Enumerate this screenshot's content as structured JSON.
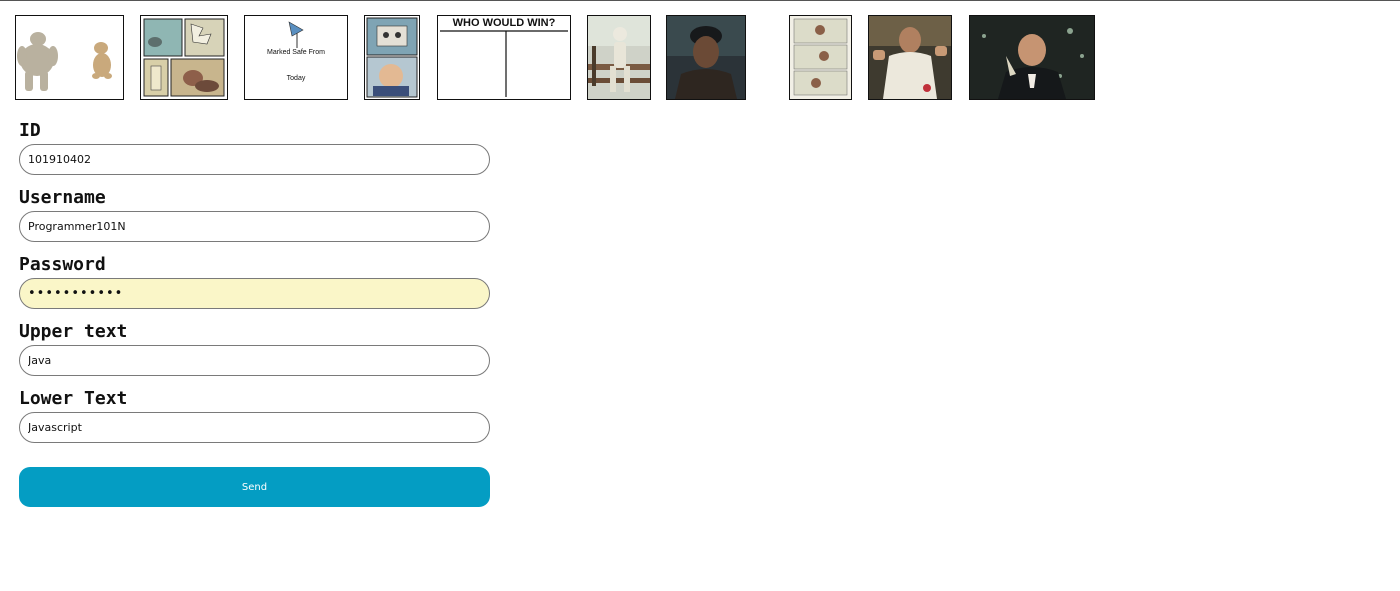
{
  "templates": [
    {
      "name": "swole-doge-vs-cheems"
    },
    {
      "name": "comic-strip"
    },
    {
      "name": "marked-safe-from",
      "text_top": "Marked Safe From",
      "text_bottom": "Today"
    },
    {
      "name": "two-buttons-comic"
    },
    {
      "name": "who-would-win",
      "text_top": "WHO WOULD WIN?"
    },
    {
      "name": "skeleton-on-bench"
    },
    {
      "name": "man-in-hat"
    },
    {
      "name": "three-panel-comic"
    },
    {
      "name": "buddy-christ"
    },
    {
      "name": "leonardo-toast"
    }
  ],
  "form": {
    "id": {
      "label": "ID",
      "value": "101910402"
    },
    "username": {
      "label": "Username",
      "value": "Programmer101N"
    },
    "password": {
      "label": "Password",
      "value": "•••••••••••"
    },
    "upper_text": {
      "label": "Upper text",
      "value": "Java"
    },
    "lower_text": {
      "label": "Lower Text",
      "value": "Javascript"
    },
    "send_label": "Send"
  },
  "colors": {
    "send_button": "#049dc3",
    "autofill_background": "#faf6c8"
  }
}
